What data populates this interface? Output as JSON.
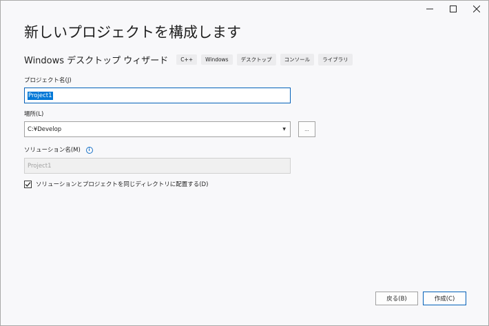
{
  "window": {
    "title": "新しいプロジェクトを構成します",
    "controls": [
      "minimize-icon",
      "maximize-icon",
      "close-icon"
    ]
  },
  "wizard": {
    "title": "Windows デスクトップ ウィザード",
    "tags": [
      "C++",
      "Windows",
      "デスクトップ",
      "コンソール",
      "ライブラリ"
    ]
  },
  "project_name": {
    "label": "プロジェクト名(J)",
    "value": "Project1"
  },
  "location": {
    "label": "場所(L)",
    "value": "C:¥Develop",
    "browse_label": "..."
  },
  "solution_name": {
    "label": "ソリューション名(M)",
    "placeholder": "Project1"
  },
  "same_directory": {
    "label": "ソリューションとプロジェクトを同じディレクトリに配置する(D)",
    "checked": true
  },
  "buttons": {
    "back": "戻る(B)",
    "create": "作成(C)"
  },
  "colors": {
    "accent": "#005fb8",
    "selection": "#0078d7",
    "info": "#1a73c8"
  }
}
